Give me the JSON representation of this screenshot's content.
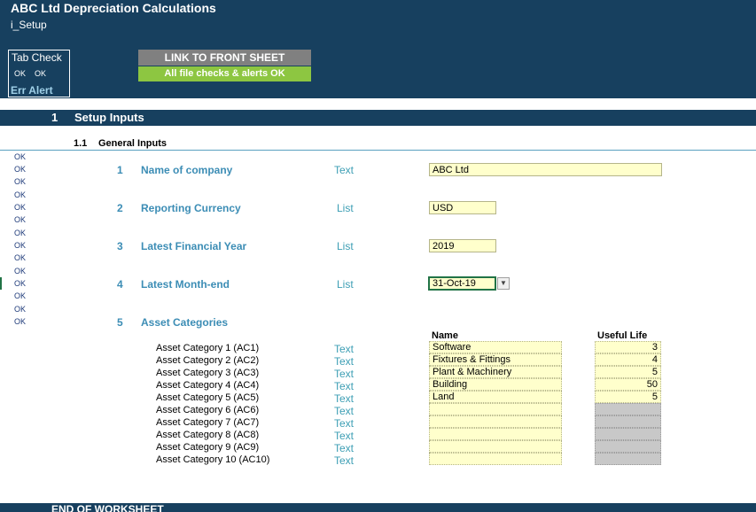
{
  "header": {
    "title": "ABC Ltd Depreciation Calculations",
    "sheet": "i_Setup",
    "tab_check_label": "Tab Check",
    "tab_check_ok_1": "OK",
    "tab_check_ok_2": "OK",
    "err_alert": "Err Alert",
    "link_button": "LINK TO FRONT SHEET",
    "checks_status": "All file checks & alerts OK"
  },
  "section": {
    "number": "1",
    "title": "Setup Inputs"
  },
  "subsection": {
    "number": "1.1",
    "title": "General Inputs"
  },
  "ok_column": [
    "OK",
    "OK",
    "OK",
    "OK",
    "OK",
    "OK",
    "OK",
    "OK",
    "OK",
    "OK",
    "OK",
    "OK",
    "OK",
    "OK"
  ],
  "inputs": [
    {
      "num": "1",
      "label": "Name of company",
      "type": "Text",
      "value": "ABC Ltd"
    },
    {
      "num": "2",
      "label": "Reporting Currency",
      "type": "List",
      "value": "USD"
    },
    {
      "num": "3",
      "label": "Latest Financial Year",
      "type": "List",
      "value": "2019"
    },
    {
      "num": "4",
      "label": "Latest Month-end",
      "type": "List",
      "value": "31-Oct-19"
    },
    {
      "num": "5",
      "label": "Asset Categories"
    }
  ],
  "categories": {
    "name_header": "Name",
    "life_header": "Useful Life",
    "rows": [
      {
        "label": "Asset Category 1 (AC1)",
        "type": "Text",
        "name": "Software",
        "life": "3"
      },
      {
        "label": "Asset Category 2 (AC2)",
        "type": "Text",
        "name": "Fixtures & Fittings",
        "life": "4"
      },
      {
        "label": "Asset Category 3 (AC3)",
        "type": "Text",
        "name": "Plant & Machinery",
        "life": "5"
      },
      {
        "label": "Asset Category 4 (AC4)",
        "type": "Text",
        "name": "Building",
        "life": "50"
      },
      {
        "label": "Asset Category 5 (AC5)",
        "type": "Text",
        "name": "Land",
        "life": "5"
      },
      {
        "label": "Asset Category 6 (AC6)",
        "type": "Text",
        "name": "",
        "life": ""
      },
      {
        "label": "Asset Category 7 (AC7)",
        "type": "Text",
        "name": "",
        "life": ""
      },
      {
        "label": "Asset Category 8 (AC8)",
        "type": "Text",
        "name": "",
        "life": ""
      },
      {
        "label": "Asset Category 9 (AC9)",
        "type": "Text",
        "name": "",
        "life": ""
      },
      {
        "label": "Asset Category 10 (AC10)",
        "type": "Text",
        "name": "",
        "life": ""
      }
    ]
  },
  "footer": {
    "text": "END OF WORKSHEET"
  },
  "colors": {
    "header_bg": "#17405f",
    "link_btn": "#808080",
    "status_ok": "#8dc641",
    "input_fill": "#ffffcc",
    "label_blue": "#3c8db5"
  },
  "icons": {
    "dropdown": "chevron-down-icon"
  }
}
